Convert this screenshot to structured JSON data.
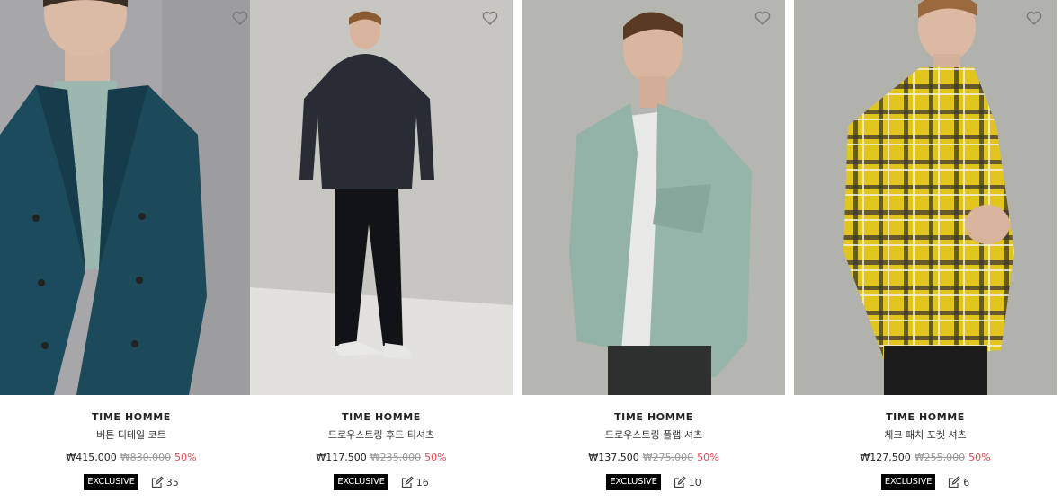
{
  "products": [
    {
      "brand": "TIME HOMME",
      "name": "버튼 디테일 코트",
      "price": "₩415,000",
      "original_price": "₩830,000",
      "discount": "50%",
      "badge": "EXCLUSIVE",
      "review_count": "35",
      "bg_color": "#a9a9ab",
      "garment_color": "#1d4a5c"
    },
    {
      "brand": "TIME HOMME",
      "name": "드로우스트링 후드 티셔츠",
      "price": "₩117,500",
      "original_price": "₩235,000",
      "discount": "50%",
      "badge": "EXCLUSIVE",
      "review_count": "16",
      "bg_color": "#c9c8c3",
      "garment_color": "#262b33"
    },
    {
      "brand": "TIME HOMME",
      "name": "드로우스트링 플랩 셔츠",
      "price": "₩137,500",
      "original_price": "₩275,000",
      "discount": "50%",
      "badge": "EXCLUSIVE",
      "review_count": "10",
      "bg_color": "#b8b8b2",
      "garment_color": "#94b3a9"
    },
    {
      "brand": "TIME HOMME",
      "name": "체크 패치 포켓 셔츠",
      "price": "₩127,500",
      "original_price": "₩255,000",
      "discount": "50%",
      "badge": "EXCLUSIVE",
      "review_count": "6",
      "bg_color": "#b3b3ae",
      "garment_color": "#e0c21e"
    }
  ],
  "colors": {
    "discount": "#e8494f",
    "badge_bg": "#000000",
    "strike": "#999999"
  },
  "icons": [
    "heart-icon",
    "review-edit-icon"
  ]
}
